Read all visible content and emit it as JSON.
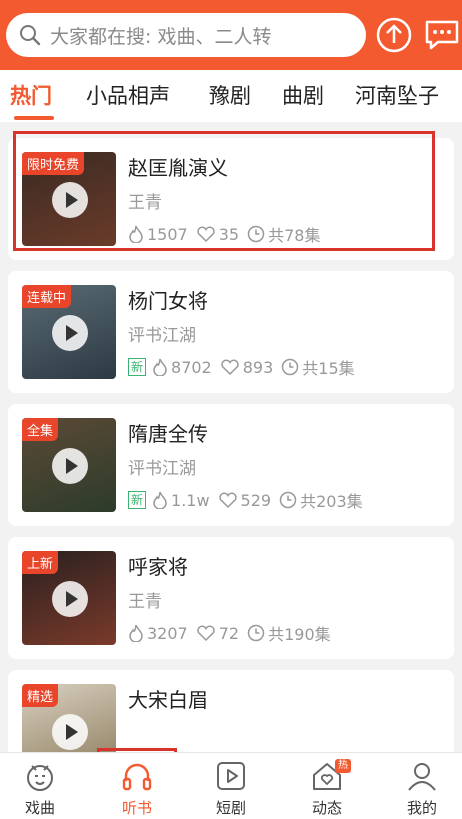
{
  "search": {
    "placeholder": "大家都在搜: 戏曲、二人转"
  },
  "tabs": [
    "热门",
    "小品相声",
    "豫剧",
    "曲剧",
    "河南坠子"
  ],
  "cards": [
    {
      "badge": "限时免费",
      "title": "赵匡胤演义",
      "author": "王青",
      "is_new": false,
      "plays": "1507",
      "likes": "35",
      "episodes": "共78集",
      "cover_colors": [
        "#3a2a22",
        "#6a3b2a"
      ]
    },
    {
      "badge": "连载中",
      "title": "杨门女将",
      "author": "评书江湖",
      "is_new": true,
      "new_label": "新",
      "plays": "8702",
      "likes": "893",
      "episodes": "共15集",
      "cover_colors": [
        "#5a6a72",
        "#2c3a44"
      ]
    },
    {
      "badge": "全集",
      "title": "隋唐全传",
      "author": "评书江湖",
      "is_new": true,
      "new_label": "新",
      "plays": "1.1w",
      "likes": "529",
      "episodes": "共203集",
      "cover_colors": [
        "#5b4a36",
        "#2d3b2a"
      ]
    },
    {
      "badge": "上新",
      "title": "呼家将",
      "author": "王青",
      "is_new": false,
      "plays": "3207",
      "likes": "72",
      "episodes": "共190集",
      "cover_colors": [
        "#2a2020",
        "#7a3a2a"
      ]
    },
    {
      "badge": "精选",
      "title": "大宋白眉",
      "author": "",
      "is_new": false,
      "plays": "",
      "likes": "",
      "episodes": "",
      "cover_colors": [
        "#d8d0c0",
        "#8a7a5a"
      ]
    }
  ],
  "bottom_nav": [
    {
      "label": "戏曲",
      "icon": "opera-face-icon"
    },
    {
      "label": "听书",
      "icon": "headphones-icon"
    },
    {
      "label": "短剧",
      "icon": "play-box-icon"
    },
    {
      "label": "动态",
      "icon": "house-heart-icon",
      "hot_badge": "热"
    },
    {
      "label": "我的",
      "icon": "person-icon"
    }
  ],
  "colors": {
    "accent": "#f45a2f",
    "highlight_box": "#d9342b"
  }
}
